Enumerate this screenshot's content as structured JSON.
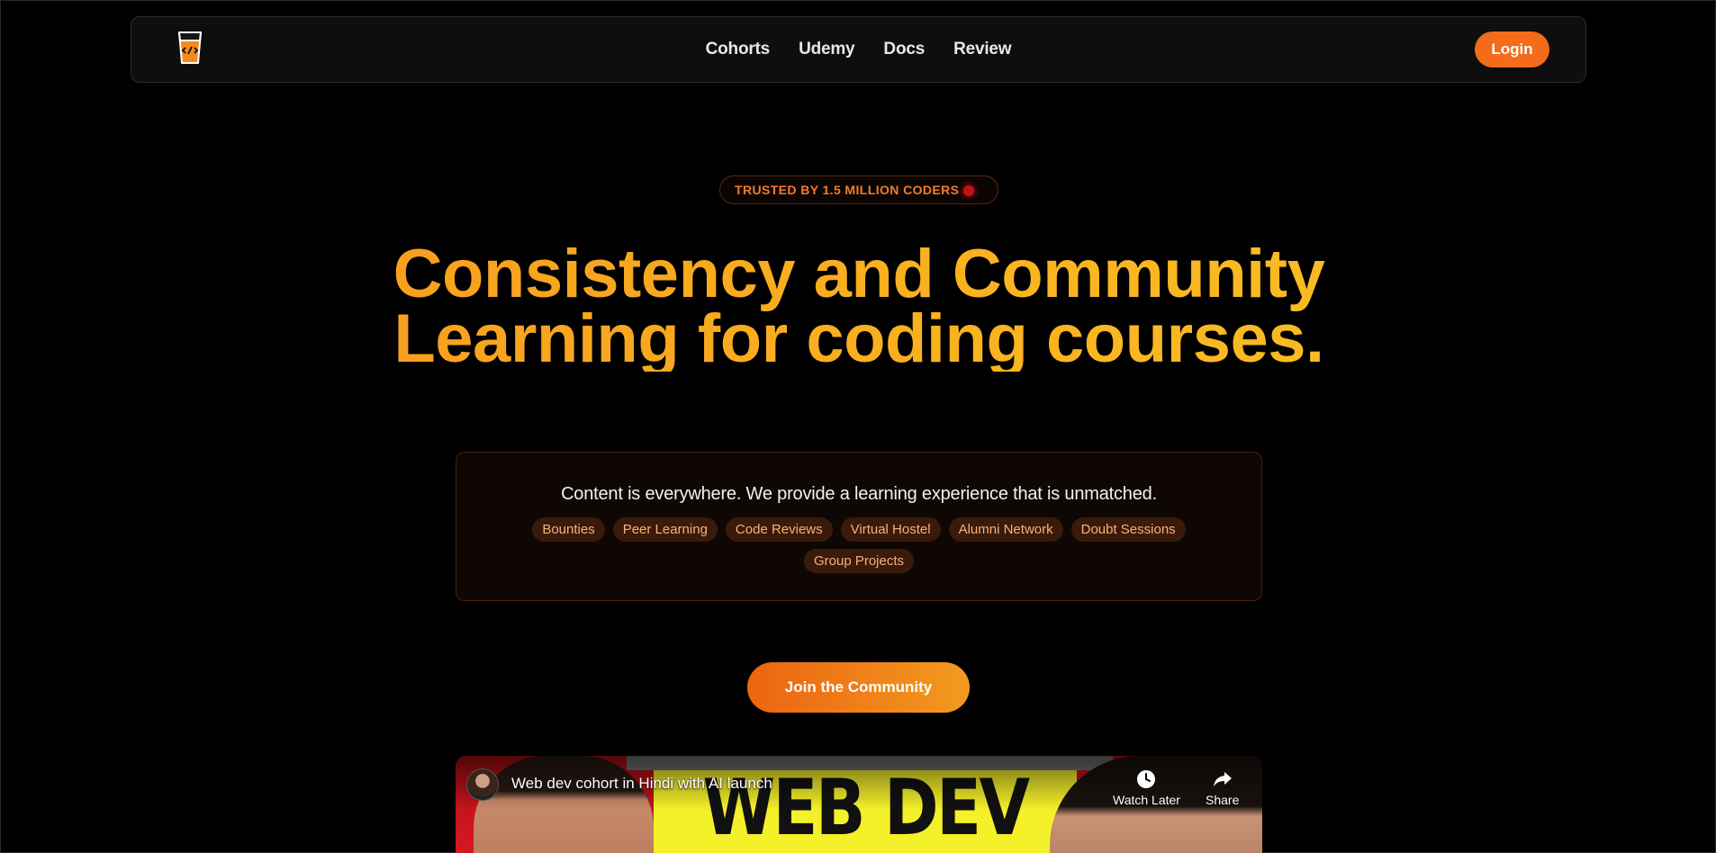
{
  "nav": {
    "logo_icon": "code-cup-logo-icon",
    "links": [
      "Cohorts",
      "Udemy",
      "Docs",
      "Review"
    ],
    "login_label": "Login",
    "accent": "#f46b1a"
  },
  "hero": {
    "badge": "TRUSTED BY 1.5 MILLION CODERS",
    "title_line1": "Consistency and Community",
    "title_line2": "Learning for coding courses.",
    "gradient": [
      "#f7931e",
      "#f8c52a"
    ]
  },
  "features": {
    "text": "Content is everywhere. We provide a learning experience that is unmatched.",
    "chips": [
      "Bounties",
      "Peer Learning",
      "Code Reviews",
      "Virtual Hostel",
      "Alumni Network",
      "Doubt Sessions",
      "Group Projects"
    ]
  },
  "cta": {
    "join_label": "Join the Community"
  },
  "video": {
    "title": "Web dev cohort in Hindi with AI launch",
    "thumbnail_text": "WEB DEV",
    "watch_later_label": "Watch Later",
    "share_label": "Share",
    "watch_later_icon": "clock-icon",
    "share_icon": "share-arrow-icon"
  }
}
